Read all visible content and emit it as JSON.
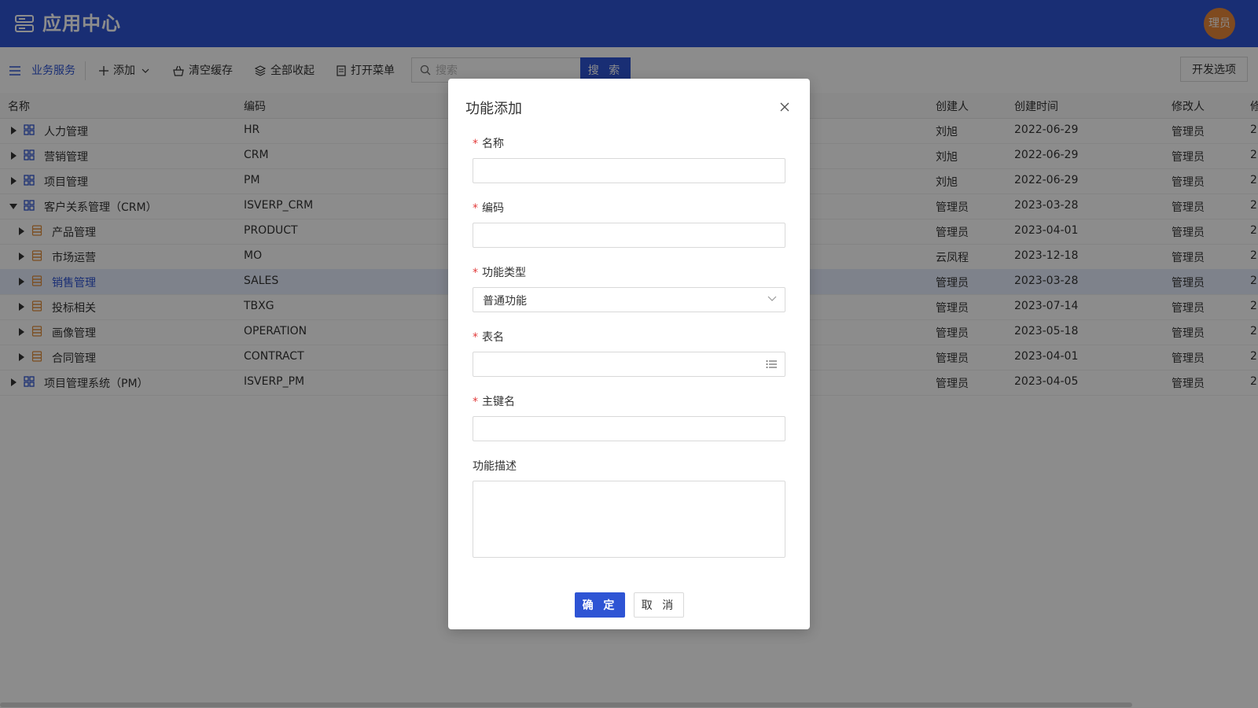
{
  "header": {
    "title": "应用中心",
    "avatar_text": "理员"
  },
  "toolbar": {
    "biz_label": "业务服务",
    "add_label": "添加",
    "clear_cache_label": "清空缓存",
    "collapse_all_label": "全部收起",
    "open_menu_label": "打开菜单",
    "search_placeholder": "搜索",
    "search_button": "搜 索",
    "dev_options": "开发选项"
  },
  "table": {
    "columns": [
      "名称",
      "编码",
      "创建人",
      "创建时间",
      "修改人",
      "修"
    ],
    "rows": [
      {
        "name": "人力管理",
        "code": "HR",
        "creator": "刘旭",
        "created": "2022-06-29",
        "modifier": "管理员",
        "more": "2",
        "level": 0,
        "expanded": false,
        "icon": "module-icon"
      },
      {
        "name": "营销管理",
        "code": "CRM",
        "creator": "刘旭",
        "created": "2022-06-29",
        "modifier": "管理员",
        "more": "2",
        "level": 0,
        "expanded": false,
        "icon": "module-icon"
      },
      {
        "name": "项目管理",
        "code": "PM",
        "creator": "刘旭",
        "created": "2022-06-29",
        "modifier": "管理员",
        "more": "2",
        "level": 0,
        "expanded": false,
        "icon": "module-icon"
      },
      {
        "name": "客户关系管理（CRM）",
        "code": "ISVERP_CRM",
        "creator": "管理员",
        "created": "2023-03-28",
        "modifier": "管理员",
        "more": "2",
        "level": 0,
        "expanded": true,
        "icon": "module-icon"
      },
      {
        "name": "产品管理",
        "code": "PRODUCT",
        "creator": "管理员",
        "created": "2023-04-01",
        "modifier": "管理员",
        "more": "2",
        "level": 1,
        "expanded": false,
        "icon": "database-icon"
      },
      {
        "name": "市场运营",
        "code": "MO",
        "creator": "云凤程",
        "created": "2023-12-18",
        "modifier": "管理员",
        "more": "2",
        "level": 1,
        "expanded": false,
        "icon": "database-icon"
      },
      {
        "name": "销售管理",
        "code": "SALES",
        "creator": "管理员",
        "created": "2023-03-28",
        "modifier": "管理员",
        "more": "2",
        "level": 1,
        "expanded": false,
        "icon": "database-icon",
        "selected": true
      },
      {
        "name": "投标相关",
        "code": "TBXG",
        "creator": "管理员",
        "created": "2023-07-14",
        "modifier": "管理员",
        "more": "2",
        "level": 1,
        "expanded": false,
        "icon": "database-icon"
      },
      {
        "name": "画像管理",
        "code": "OPERATION",
        "creator": "管理员",
        "created": "2023-05-18",
        "modifier": "管理员",
        "more": "2",
        "level": 1,
        "expanded": false,
        "icon": "database-icon"
      },
      {
        "name": "合同管理",
        "code": "CONTRACT",
        "creator": "管理员",
        "created": "2023-04-01",
        "modifier": "管理员",
        "more": "2",
        "level": 1,
        "expanded": false,
        "icon": "database-icon"
      },
      {
        "name": "项目管理系统（PM）",
        "code": "ISVERP_PM",
        "creator": "管理员",
        "created": "2023-04-05",
        "modifier": "管理员",
        "more": "2",
        "level": 0,
        "expanded": false,
        "icon": "module-icon"
      }
    ]
  },
  "modal": {
    "title": "功能添加",
    "fields": {
      "name_label": "名称",
      "code_label": "编码",
      "type_label": "功能类型",
      "type_value": "普通功能",
      "table_label": "表名",
      "pk_label": "主键名",
      "desc_label": "功能描述"
    },
    "required_mark": "*",
    "ok_button": "确 定",
    "cancel_button": "取 消"
  },
  "colors": {
    "primary": "#2e54d4",
    "avatar": "#e8883a",
    "required": "#e23c3c",
    "db_icon": "#e08c3a"
  }
}
